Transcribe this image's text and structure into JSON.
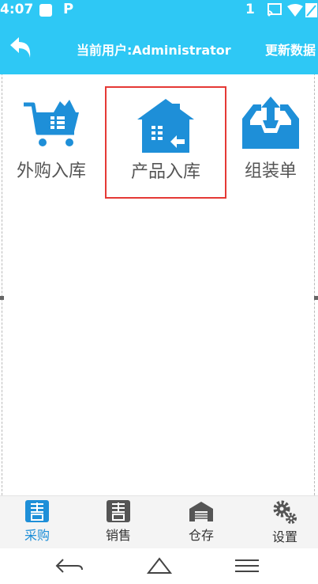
{
  "status_bar": {
    "time": "4:07",
    "notification_count": "1",
    "p_glyph": "P"
  },
  "app_bar": {
    "user_label": "当前用户:Administrator",
    "refresh_label": "更新数据"
  },
  "tiles": [
    {
      "label": "外购入库",
      "icon": "shopping-cart-icon",
      "selected": false
    },
    {
      "label": "产品入库",
      "icon": "warehouse-in-icon",
      "selected": true
    },
    {
      "label": "组装单",
      "icon": "inbox-upload-icon",
      "selected": false
    }
  ],
  "bottom_nav": [
    {
      "label": "采购",
      "icon": "purchase-icon",
      "active": true
    },
    {
      "label": "销售",
      "icon": "sales-icon",
      "active": false
    },
    {
      "label": "仓存",
      "icon": "warehouse-icon",
      "active": false
    },
    {
      "label": "设置",
      "icon": "gear-icon",
      "active": false
    }
  ],
  "system_nav": [
    "back-icon",
    "home-icon",
    "menu-icon"
  ],
  "colors": {
    "primary": "#2ec8f5",
    "icon_blue": "#1e8fd8",
    "highlight_border": "#e53935",
    "nav_icon_gray": "#555555"
  }
}
